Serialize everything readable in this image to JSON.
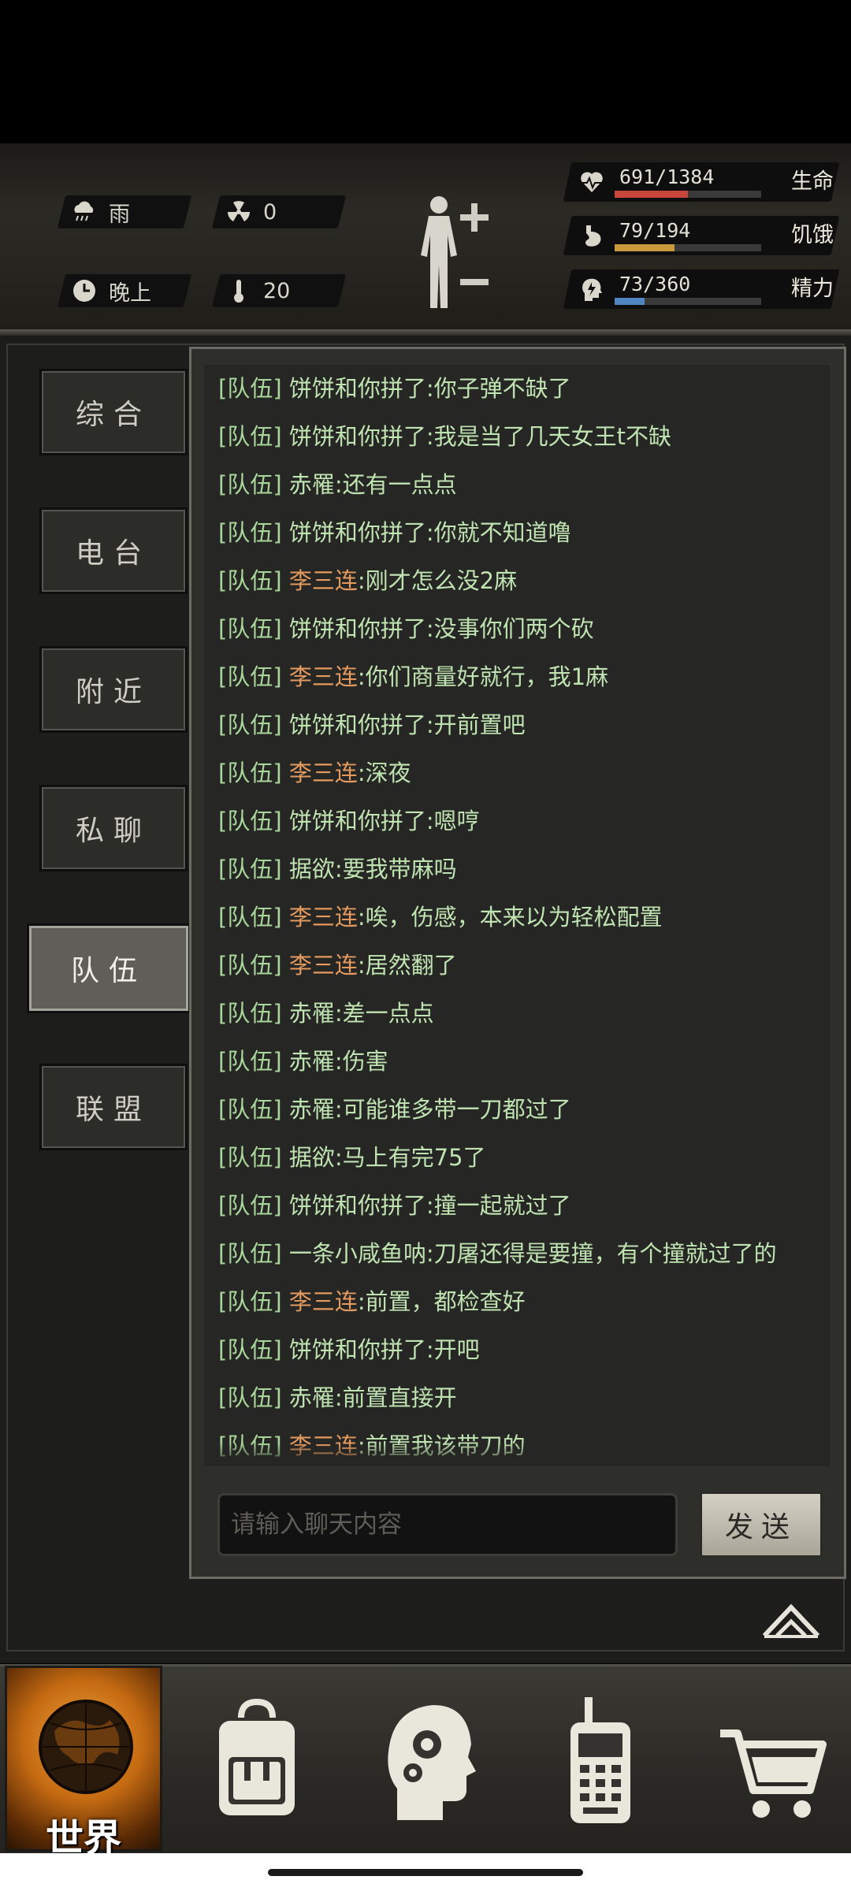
{
  "hud": {
    "weather": "雨",
    "radiation": "0",
    "time_of_day": "晚上",
    "temperature": "20",
    "stats": [
      {
        "value": "691/1384",
        "label": "生命",
        "fraction": 0.499,
        "color": "#c8463c",
        "icon": "heartbeat-icon"
      },
      {
        "value": "79/194",
        "label": "饥饿",
        "fraction": 0.407,
        "color": "#c99a3c",
        "icon": "stomach-icon"
      },
      {
        "value": "73/360",
        "label": "精力",
        "fraction": 0.203,
        "color": "#4f86c0",
        "icon": "head-energy-icon"
      }
    ]
  },
  "tabs": [
    {
      "label": "综合",
      "active": false
    },
    {
      "label": "电台",
      "active": false
    },
    {
      "label": "附近",
      "active": false
    },
    {
      "label": "私聊",
      "active": false
    },
    {
      "label": "队伍",
      "active": true
    },
    {
      "label": "联盟",
      "active": false
    }
  ],
  "chat": {
    "channel_tag": "[队伍]",
    "messages": [
      {
        "name": "饼饼和你拼了",
        "text": ":你子弹不缺了",
        "color": "green"
      },
      {
        "name": "饼饼和你拼了",
        "text": ":我是当了几天女王t不缺",
        "color": "green"
      },
      {
        "name": "赤罹",
        "text": ":还有一点点",
        "color": "green"
      },
      {
        "name": "饼饼和你拼了",
        "text": ":你就不知道噜",
        "color": "green"
      },
      {
        "name": "李三连",
        "text": ":刚才怎么没2麻",
        "color": "orange"
      },
      {
        "name": "饼饼和你拼了",
        "text": ":没事你们两个砍",
        "color": "green"
      },
      {
        "name": "李三连",
        "text": ":你们商量好就行，我1麻",
        "color": "orange"
      },
      {
        "name": "饼饼和你拼了",
        "text": ":开前置吧",
        "color": "green"
      },
      {
        "name": "李三连",
        "text": ":深夜",
        "color": "orange"
      },
      {
        "name": "饼饼和你拼了",
        "text": ":嗯哼",
        "color": "green"
      },
      {
        "name": "据欲",
        "text": ":要我带麻吗",
        "color": "green"
      },
      {
        "name": "李三连",
        "text": ":唉，伤感，本来以为轻松配置",
        "color": "orange"
      },
      {
        "name": "李三连",
        "text": ":居然翻了",
        "color": "orange"
      },
      {
        "name": "赤罹",
        "text": ":差一点点",
        "color": "green"
      },
      {
        "name": "赤罹",
        "text": ":伤害",
        "color": "green"
      },
      {
        "name": "赤罹",
        "text": ":可能谁多带一刀都过了",
        "color": "green"
      },
      {
        "name": "据欲",
        "text": ":马上有完75了",
        "color": "green"
      },
      {
        "name": "饼饼和你拼了",
        "text": ":撞一起就过了",
        "color": "green"
      },
      {
        "name": "一条小咸鱼呐",
        "text": ":刀屠还得是要撞，有个撞就过了的",
        "color": "green"
      },
      {
        "name": "李三连",
        "text": ":前置，都检查好",
        "color": "orange"
      },
      {
        "name": "饼饼和你拼了",
        "text": ":开吧",
        "color": "green"
      },
      {
        "name": "赤罹",
        "text": ":前置直接开",
        "color": "green"
      },
      {
        "name": "李三连",
        "text": ":前置我该带刀的",
        "color": "orange"
      }
    ],
    "input_placeholder": "请输入聊天内容",
    "send_label": "发送"
  },
  "nav": {
    "world_label": "世界",
    "items": [
      "backpack-icon",
      "brain-gear-icon",
      "radio-icon",
      "cart-icon"
    ]
  }
}
